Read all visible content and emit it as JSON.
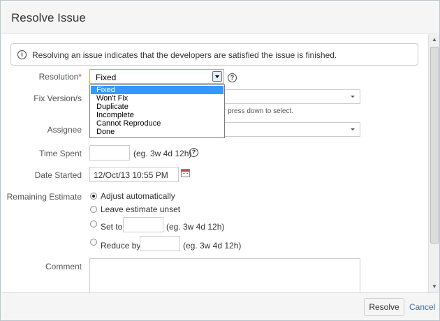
{
  "dialog": {
    "title": "Resolve Issue"
  },
  "info": {
    "message": "Resolving an issue indicates that the developers are satisfied the issue is finished."
  },
  "form": {
    "resolution": {
      "label": "Resolution",
      "required_mark": "*",
      "value": "Fixed",
      "options": [
        "Fixed",
        "Won't Fix",
        "Duplicate",
        "Incomplete",
        "Cannot Reproduce",
        "Done"
      ],
      "selected_index": 0
    },
    "fix_version": {
      "label": "Fix Version/s",
      "hint": "r press down to select."
    },
    "assignee": {
      "label": "Assignee"
    },
    "time_spent": {
      "label": "Time Spent",
      "hint": "(eg. 3w 4d 12h)"
    },
    "date_started": {
      "label": "Date Started",
      "value": "12/Oct/13 10:55 PM"
    },
    "remaining_estimate": {
      "label": "Remaining Estimate",
      "adjust_automatically": "Adjust automatically",
      "leave_unset": "Leave estimate unset",
      "set_to": "Set to",
      "set_to_hint": "(eg. 3w 4d 12h)",
      "reduce_by": "Reduce by",
      "reduce_by_hint": "(eg. 3w 4d 12h)",
      "selected": "adjust_automatically"
    },
    "comment": {
      "label": "Comment"
    }
  },
  "footer": {
    "resolve_label": "Resolve",
    "cancel_label": "Cancel"
  },
  "icons": {
    "info": "info-icon",
    "help": "help-icon",
    "calendar": "calendar-icon"
  },
  "colors": {
    "link": "#3572b0",
    "selected_option": "#3399ff",
    "required": "#d04437"
  }
}
